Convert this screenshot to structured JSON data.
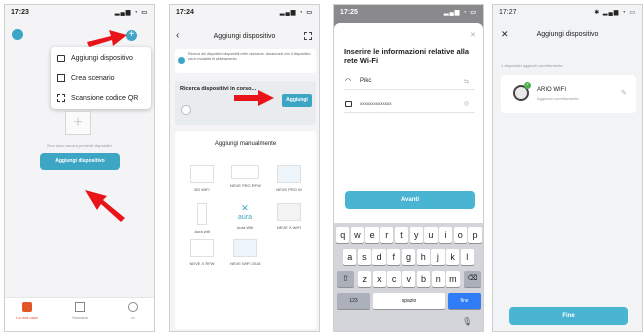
{
  "phone1": {
    "time": "17:23",
    "menu": [
      "Aggiungi dispositivo",
      "Crea scenario",
      "Scansione codice QR"
    ],
    "empty_text": "Non sono ancora presenti dispositivi",
    "add_button": "Aggiungi dispositivo",
    "tabs": [
      "La mia casa",
      "Scenario",
      "Io"
    ]
  },
  "phone2": {
    "time": "17:24",
    "title": "Aggiungi dispositivo",
    "bt_notice": "Ricerca dei dispositivi disponibili nelle vicinanze. Assicurarsi che il dispositivo sia in modalità di abbinamento.",
    "search_label": "Ricerca dispositivi in corso...",
    "search_button": "Aggiungi",
    "manual_title": "Aggiungi manualmente",
    "devices": [
      "BG WIFI",
      "NEVE PRO RFW",
      "NEVE PRO W",
      "Aura wifi",
      "Aura Wifi",
      "NEVE X WIFI",
      "NEVE X RFW",
      "NEVE WIFI 2018"
    ],
    "aura_text": "aura"
  },
  "phone3": {
    "time": "17:25",
    "heading": "Inserire le informazioni relative alla rete Wi-Fi",
    "wifi_name": "Pikc",
    "password": "xxxxxxxxxxxxxx",
    "next_button": "Avanti",
    "row1": [
      "q",
      "w",
      "e",
      "r",
      "t",
      "y",
      "u",
      "i",
      "o",
      "p"
    ],
    "row2": [
      "a",
      "s",
      "d",
      "f",
      "g",
      "h",
      "j",
      "k",
      "l"
    ],
    "row3": [
      "z",
      "x",
      "c",
      "v",
      "b",
      "n",
      "m"
    ],
    "key_123": "123",
    "key_space": "spazio",
    "key_done": "fine"
  },
  "phone4": {
    "time": "17:27",
    "title": "Aggiungi dispositivo",
    "added_text": "1 dispositivi aggiunti correttamente",
    "device_name": "ARIO WIFI",
    "device_status": "Aggiunto correttamente",
    "done_button": "Fine"
  },
  "colors": {
    "accent": "#3ea6c5",
    "arrow": "#e8141a",
    "keyboard_blue": "#2f7cf6"
  }
}
